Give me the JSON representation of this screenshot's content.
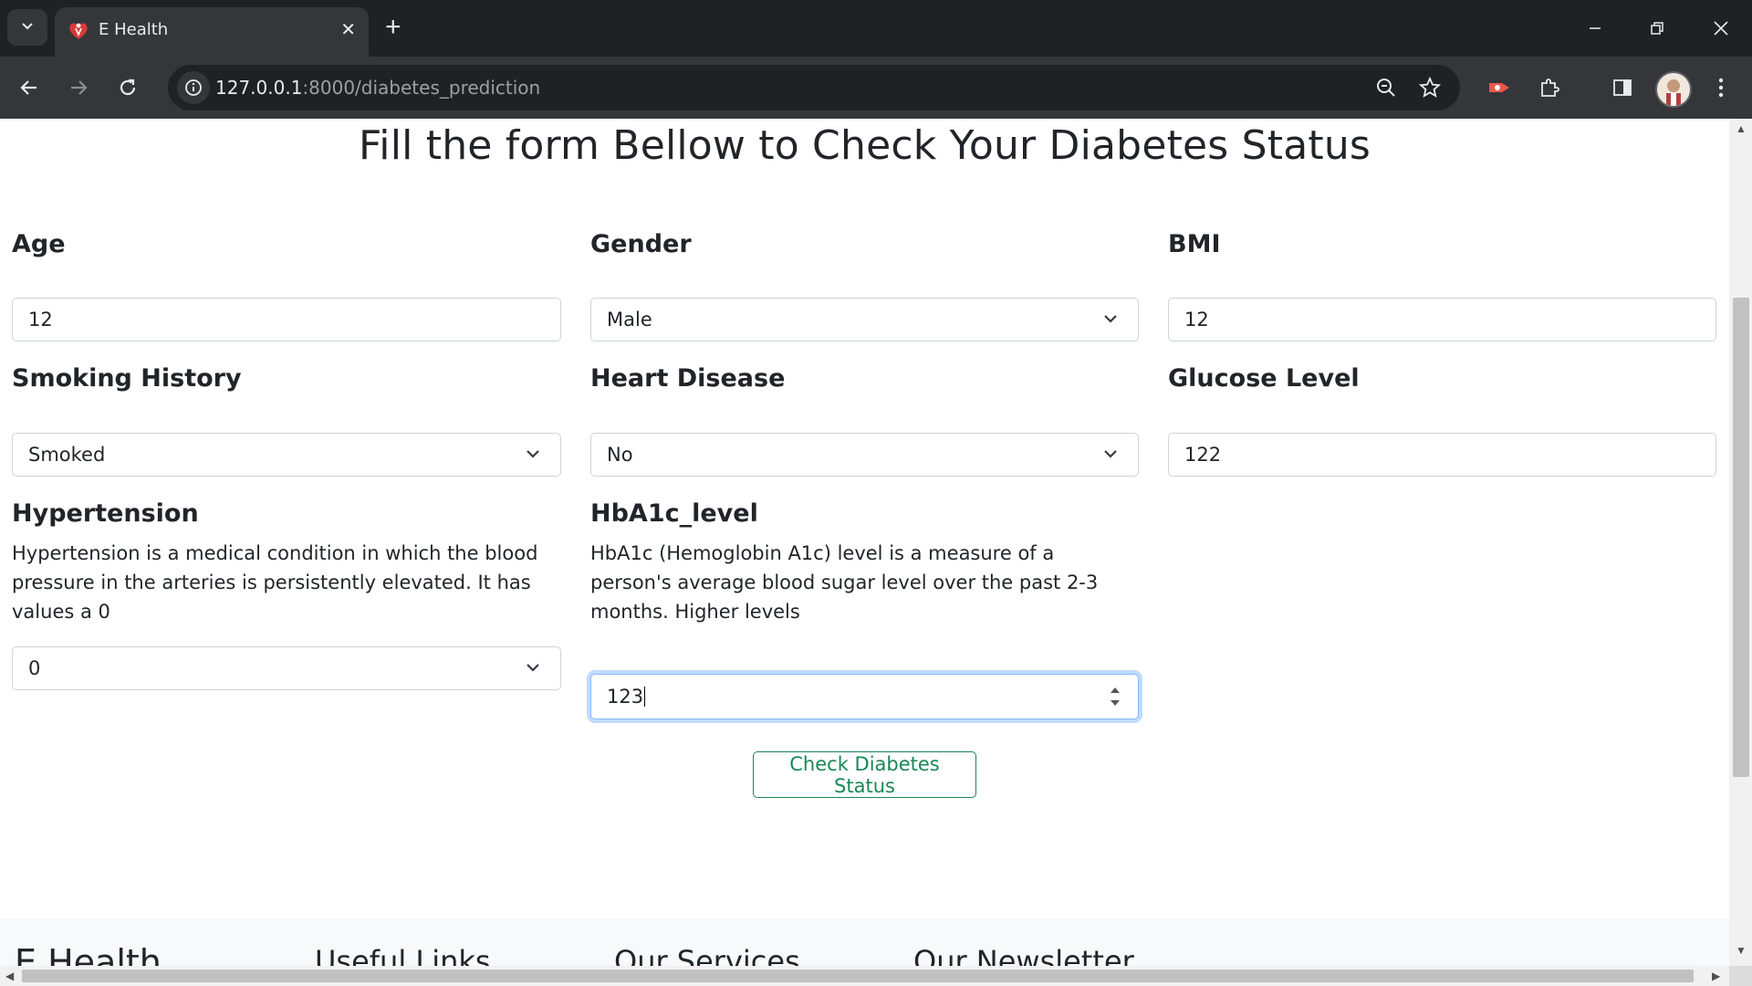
{
  "browser": {
    "tab_title": "E Health",
    "url_host": "127.0.0.1",
    "url_path": ":8000/diabetes_prediction"
  },
  "page": {
    "heading": "Fill the form Bellow to Check Your Diabetes Status",
    "fields": {
      "age": {
        "label": "Age",
        "value": "12"
      },
      "gender": {
        "label": "Gender",
        "value": "Male"
      },
      "bmi": {
        "label": "BMI",
        "value": "12"
      },
      "smoking": {
        "label": "Smoking History",
        "value": "Smoked"
      },
      "heart": {
        "label": "Heart Disease",
        "value": "No"
      },
      "glucose": {
        "label": "Glucose Level",
        "value": "122"
      },
      "hypertension": {
        "label": "Hypertension",
        "description": "Hypertension is a medical condition in which the blood pressure in the arteries is persistently elevated. It has values a 0",
        "value": "0"
      },
      "hba1c": {
        "label": "HbA1c_level",
        "description": "HbA1c (Hemoglobin A1c) level is a measure of a person's average blood sugar level over the past 2-3 months. Higher levels",
        "value": "123"
      }
    },
    "submit_label": "Check Diabetes Status"
  },
  "footer": {
    "brand": "E Health",
    "useful_links": "Useful Links",
    "our_services": "Our Services",
    "our_newsletter": "Our Newsletter"
  },
  "colors": {
    "chrome_dark": "#202124",
    "chrome_toolbar": "#35363a",
    "success": "#198754",
    "focus": "#86b7fe"
  }
}
